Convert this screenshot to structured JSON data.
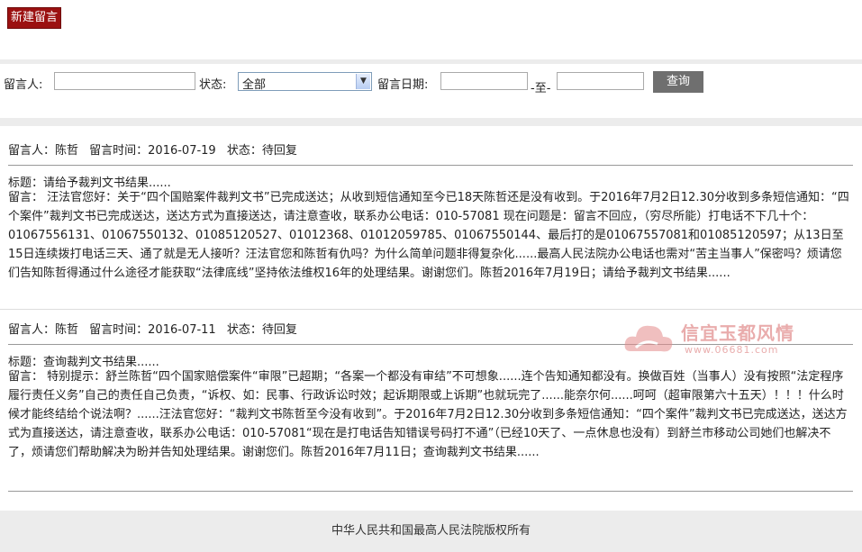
{
  "toolbar": {
    "new_label": "新建留言"
  },
  "search": {
    "author_label": "留言人:",
    "author_value": "",
    "status_label": "状态:",
    "status_value": "全部",
    "date_label": "留言日期:",
    "date_from": "",
    "date_sep": "-至-",
    "date_to": "",
    "query_label": "查询"
  },
  "messages": [
    {
      "author": "留言人：陈哲",
      "time": "留言时间：2016-07-19",
      "status": "状态：待回复",
      "title": "标题：请给予裁判文书结果......",
      "content": "留言：  汪法官您好：关于“四个国赔案件裁判文书”已完成送达；从收到短信通知至今已18天陈哲还是没有收到。于2016年7月2日12.30分收到多条短信通知：“四个案件”裁判文书已完成送达，送达方式为直接送达，请注意查收，联系办公电话：010-57081 现在问题是：留言不回应，（穷尽所能）打电话不下几十个：01067556131、01067550132、01085120527、01012368、01012059785、01067550144、最后打的是01067557081和01085120597；从13日至15日连续拨打电话三天、通了就是无人接听？汪法官您和陈哲有仇吗？为什么简单问题非得复杂化......最高人民法院办公电话也需对“苦主当事人”保密吗？烦请您们告知陈哲得通过什么途径才能获取“法律底线”坚持依法维权16年的处理结果。谢谢您们。陈哲2016年7月19日；请给予裁判文书结果......"
    },
    {
      "author": "留言人：陈哲",
      "time": "留言时间：2016-07-11",
      "status": "状态：待回复",
      "title": "标题：查询裁判文书结果......",
      "content": "留言：  特别提示：舒兰陈哲“四个国家赔偿案件“审限”已超期；“各案一个都没有审结”不可想象......连个告知通知都没有。换做百姓（当事人）没有按照“法定程序履行责任义务”自己的责任自己负责，“诉权、如：民事、行政诉讼时效；起诉期限或上诉期”也就玩完了......能奈尔何......呵呵（超审限第六十五天）！！！什么时候才能终结给个说法啊？......汪法官您好：“裁判文书陈哲至今没有收到”。于2016年7月2日12.30分收到多条短信通知：“四个案件”裁判文书已完成送达，送达方式为直接送达，请注意查收，联系办公电话：010-57081“现在是打电话告知错误号码打不通”（已经10天了、一点休息也没有）到舒兰市移动公司她们也解决不了，烦请您们帮助解决为盼并告知处理结果。谢谢您们。陈哲2016年7月11日；查询裁判文书结果......"
    }
  ],
  "watermark": {
    "text": "信宜玉都风情",
    "url": "www.06681.com"
  },
  "footer": {
    "copyright": "中华人民共和国最高人民法院版权所有"
  },
  "colors": {
    "new_button": "#9b1111",
    "query_button": "#6f6f6f",
    "band": "#ececec"
  }
}
